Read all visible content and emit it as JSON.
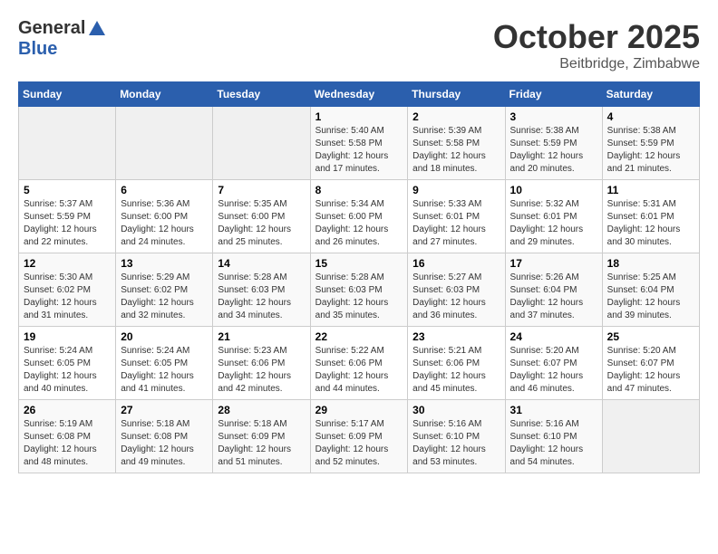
{
  "header": {
    "logo_general": "General",
    "logo_blue": "Blue",
    "month": "October 2025",
    "location": "Beitbridge, Zimbabwe"
  },
  "weekdays": [
    "Sunday",
    "Monday",
    "Tuesday",
    "Wednesday",
    "Thursday",
    "Friday",
    "Saturday"
  ],
  "weeks": [
    [
      {
        "day": "",
        "info": ""
      },
      {
        "day": "",
        "info": ""
      },
      {
        "day": "",
        "info": ""
      },
      {
        "day": "1",
        "info": "Sunrise: 5:40 AM\nSunset: 5:58 PM\nDaylight: 12 hours and 17 minutes."
      },
      {
        "day": "2",
        "info": "Sunrise: 5:39 AM\nSunset: 5:58 PM\nDaylight: 12 hours and 18 minutes."
      },
      {
        "day": "3",
        "info": "Sunrise: 5:38 AM\nSunset: 5:59 PM\nDaylight: 12 hours and 20 minutes."
      },
      {
        "day": "4",
        "info": "Sunrise: 5:38 AM\nSunset: 5:59 PM\nDaylight: 12 hours and 21 minutes."
      }
    ],
    [
      {
        "day": "5",
        "info": "Sunrise: 5:37 AM\nSunset: 5:59 PM\nDaylight: 12 hours and 22 minutes."
      },
      {
        "day": "6",
        "info": "Sunrise: 5:36 AM\nSunset: 6:00 PM\nDaylight: 12 hours and 24 minutes."
      },
      {
        "day": "7",
        "info": "Sunrise: 5:35 AM\nSunset: 6:00 PM\nDaylight: 12 hours and 25 minutes."
      },
      {
        "day": "8",
        "info": "Sunrise: 5:34 AM\nSunset: 6:00 PM\nDaylight: 12 hours and 26 minutes."
      },
      {
        "day": "9",
        "info": "Sunrise: 5:33 AM\nSunset: 6:01 PM\nDaylight: 12 hours and 27 minutes."
      },
      {
        "day": "10",
        "info": "Sunrise: 5:32 AM\nSunset: 6:01 PM\nDaylight: 12 hours and 29 minutes."
      },
      {
        "day": "11",
        "info": "Sunrise: 5:31 AM\nSunset: 6:01 PM\nDaylight: 12 hours and 30 minutes."
      }
    ],
    [
      {
        "day": "12",
        "info": "Sunrise: 5:30 AM\nSunset: 6:02 PM\nDaylight: 12 hours and 31 minutes."
      },
      {
        "day": "13",
        "info": "Sunrise: 5:29 AM\nSunset: 6:02 PM\nDaylight: 12 hours and 32 minutes."
      },
      {
        "day": "14",
        "info": "Sunrise: 5:28 AM\nSunset: 6:03 PM\nDaylight: 12 hours and 34 minutes."
      },
      {
        "day": "15",
        "info": "Sunrise: 5:28 AM\nSunset: 6:03 PM\nDaylight: 12 hours and 35 minutes."
      },
      {
        "day": "16",
        "info": "Sunrise: 5:27 AM\nSunset: 6:03 PM\nDaylight: 12 hours and 36 minutes."
      },
      {
        "day": "17",
        "info": "Sunrise: 5:26 AM\nSunset: 6:04 PM\nDaylight: 12 hours and 37 minutes."
      },
      {
        "day": "18",
        "info": "Sunrise: 5:25 AM\nSunset: 6:04 PM\nDaylight: 12 hours and 39 minutes."
      }
    ],
    [
      {
        "day": "19",
        "info": "Sunrise: 5:24 AM\nSunset: 6:05 PM\nDaylight: 12 hours and 40 minutes."
      },
      {
        "day": "20",
        "info": "Sunrise: 5:24 AM\nSunset: 6:05 PM\nDaylight: 12 hours and 41 minutes."
      },
      {
        "day": "21",
        "info": "Sunrise: 5:23 AM\nSunset: 6:06 PM\nDaylight: 12 hours and 42 minutes."
      },
      {
        "day": "22",
        "info": "Sunrise: 5:22 AM\nSunset: 6:06 PM\nDaylight: 12 hours and 44 minutes."
      },
      {
        "day": "23",
        "info": "Sunrise: 5:21 AM\nSunset: 6:06 PM\nDaylight: 12 hours and 45 minutes."
      },
      {
        "day": "24",
        "info": "Sunrise: 5:20 AM\nSunset: 6:07 PM\nDaylight: 12 hours and 46 minutes."
      },
      {
        "day": "25",
        "info": "Sunrise: 5:20 AM\nSunset: 6:07 PM\nDaylight: 12 hours and 47 minutes."
      }
    ],
    [
      {
        "day": "26",
        "info": "Sunrise: 5:19 AM\nSunset: 6:08 PM\nDaylight: 12 hours and 48 minutes."
      },
      {
        "day": "27",
        "info": "Sunrise: 5:18 AM\nSunset: 6:08 PM\nDaylight: 12 hours and 49 minutes."
      },
      {
        "day": "28",
        "info": "Sunrise: 5:18 AM\nSunset: 6:09 PM\nDaylight: 12 hours and 51 minutes."
      },
      {
        "day": "29",
        "info": "Sunrise: 5:17 AM\nSunset: 6:09 PM\nDaylight: 12 hours and 52 minutes."
      },
      {
        "day": "30",
        "info": "Sunrise: 5:16 AM\nSunset: 6:10 PM\nDaylight: 12 hours and 53 minutes."
      },
      {
        "day": "31",
        "info": "Sunrise: 5:16 AM\nSunset: 6:10 PM\nDaylight: 12 hours and 54 minutes."
      },
      {
        "day": "",
        "info": ""
      }
    ]
  ]
}
